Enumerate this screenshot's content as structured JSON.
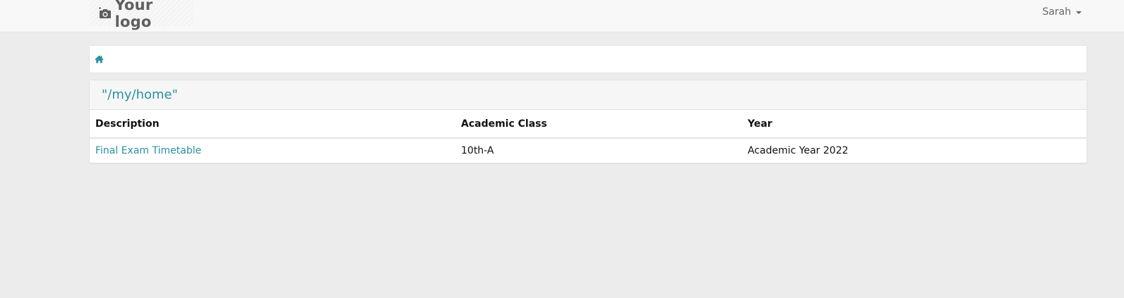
{
  "header": {
    "logo_text": "Your logo",
    "user_name": "Sarah"
  },
  "breadcrumb": {
    "home_icon": "home-icon"
  },
  "panel": {
    "title": "\"/my/home\""
  },
  "table": {
    "columns": [
      "Description",
      "Academic Class",
      "Year"
    ],
    "rows": [
      {
        "description": "Final Exam Timetable",
        "academic_class": "10th-A",
        "year": "Academic Year 2022"
      }
    ]
  },
  "colors": {
    "accent": "#2e8f9e",
    "background": "#ececec",
    "topbar": "#f8f8f8"
  }
}
